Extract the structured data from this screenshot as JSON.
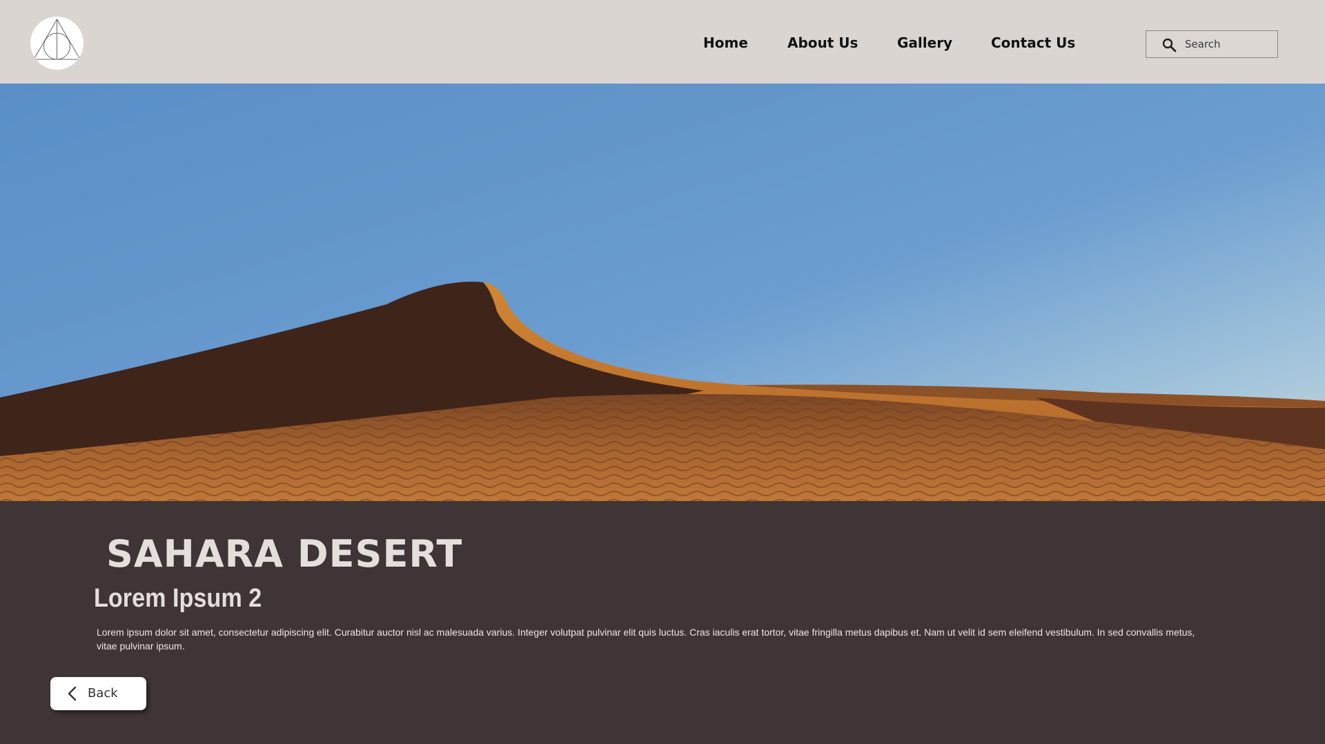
{
  "header": {
    "logo_icon": "deathly-hallows-logo-icon",
    "nav": [
      {
        "label": "Home"
      },
      {
        "label": "About Us"
      },
      {
        "label": "Gallery"
      },
      {
        "label": "Contact Us"
      }
    ],
    "search": {
      "icon": "search-icon",
      "placeholder": "Search"
    }
  },
  "hero": {
    "image": "desert-sand-dune-photo"
  },
  "content": {
    "title": "SAHARA DESERT",
    "subtitle": "Lorem Ipsum 2",
    "body": "Lorem ipsum dolor sit amet, consectetur adipiscing elit. Curabitur auctor nisl ac malesuada varius. Integer volutpat pulvinar elit quis luctus. Cras iaculis erat tortor, vitae fringilla metus dapibus et. Nam ut velit id sem eleifend vestibulum. In sed convallis metus, vitae pulvinar ipsum.",
    "back_label": "Back",
    "back_icon": "chevron-left-icon"
  },
  "colors": {
    "header_bg": "#dad5d1",
    "content_bg": "#3f3537",
    "title_text": "#e4dfdb",
    "button_bg": "#ffffff"
  }
}
